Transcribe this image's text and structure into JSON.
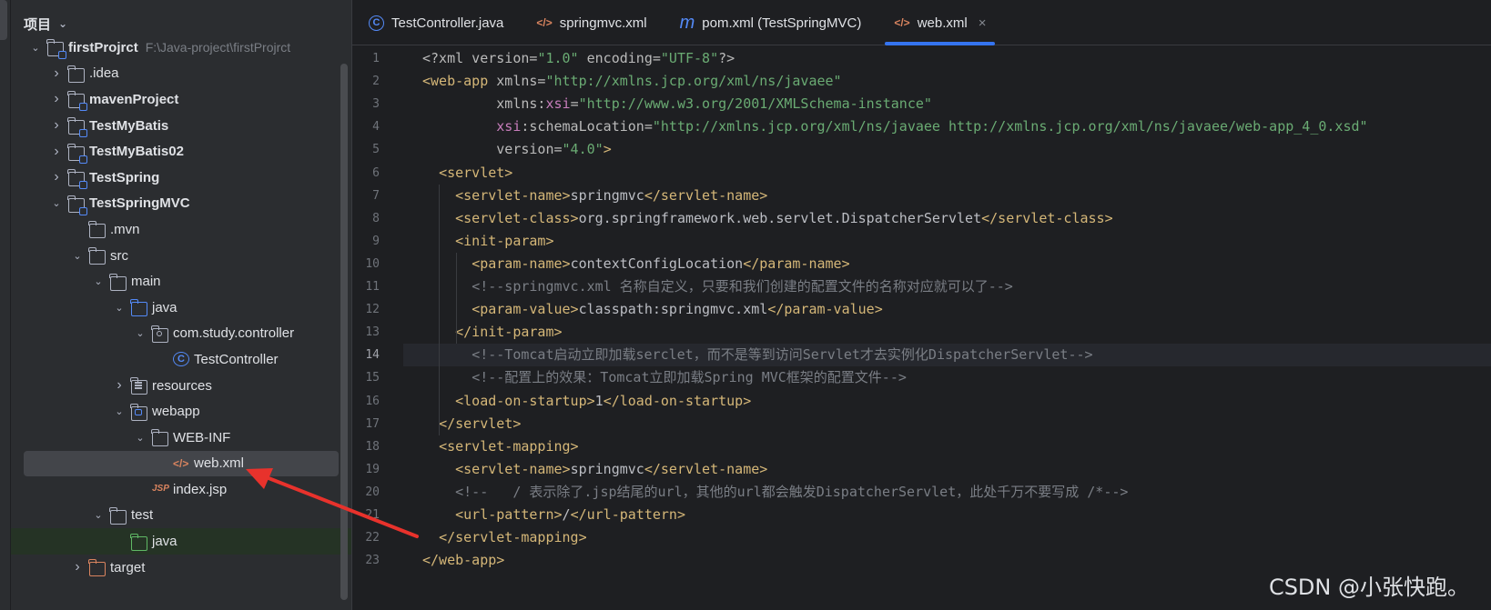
{
  "project_panel": {
    "title": "项目",
    "tree": [
      {
        "label": "firstProjrct",
        "path": "F:\\Java-project\\firstProjrct",
        "indent": 0,
        "arrow": "open",
        "icon": "module",
        "bold": true
      },
      {
        "label": ".idea",
        "indent": 1,
        "arrow": "closed",
        "icon": "folder"
      },
      {
        "label": "mavenProject",
        "indent": 1,
        "arrow": "closed",
        "icon": "module",
        "bold": true
      },
      {
        "label": "TestMyBatis",
        "indent": 1,
        "arrow": "closed",
        "icon": "module",
        "bold": true
      },
      {
        "label": "TestMyBatis02",
        "indent": 1,
        "arrow": "closed",
        "icon": "module",
        "bold": true
      },
      {
        "label": "TestSpring",
        "indent": 1,
        "arrow": "closed",
        "icon": "module",
        "bold": true
      },
      {
        "label": "TestSpringMVC",
        "indent": 1,
        "arrow": "open",
        "icon": "module",
        "bold": true
      },
      {
        "label": ".mvn",
        "indent": 2,
        "arrow": "none",
        "icon": "folder"
      },
      {
        "label": "src",
        "indent": 2,
        "arrow": "open",
        "icon": "folder"
      },
      {
        "label": "main",
        "indent": 3,
        "arrow": "open",
        "icon": "folder"
      },
      {
        "label": "java",
        "indent": 4,
        "arrow": "open",
        "icon": "folder-blue"
      },
      {
        "label": "com.study.controller",
        "indent": 5,
        "arrow": "open",
        "icon": "package"
      },
      {
        "label": "TestController",
        "indent": 6,
        "arrow": "none",
        "icon": "class"
      },
      {
        "label": "resources",
        "indent": 4,
        "arrow": "closed",
        "icon": "resources"
      },
      {
        "label": "webapp",
        "indent": 4,
        "arrow": "open",
        "icon": "webapp"
      },
      {
        "label": "WEB-INF",
        "indent": 5,
        "arrow": "open",
        "icon": "folder"
      },
      {
        "label": "web.xml",
        "indent": 6,
        "arrow": "none",
        "icon": "xml",
        "selected": true
      },
      {
        "label": "index.jsp",
        "indent": 5,
        "arrow": "none",
        "icon": "jsp"
      },
      {
        "label": "test",
        "indent": 3,
        "arrow": "open",
        "icon": "folder"
      },
      {
        "label": "java",
        "indent": 4,
        "arrow": "none",
        "icon": "folder-green",
        "band": true
      },
      {
        "label": "target",
        "indent": 2,
        "arrow": "closed",
        "icon": "folder-orange"
      }
    ]
  },
  "tabs": [
    {
      "label": "TestController.java",
      "icon": "class-icon",
      "glyph": "C",
      "active": false
    },
    {
      "label": "springmvc.xml",
      "icon": "xml-file-icon",
      "glyph": "</>",
      "active": false
    },
    {
      "label": "pom.xml (TestSpringMVC)",
      "icon": "maven-icon",
      "glyph": "m",
      "active": false
    },
    {
      "label": "web.xml",
      "icon": "xml-file-icon",
      "glyph": "</>",
      "active": true,
      "close": "×"
    }
  ],
  "editor": {
    "current_line": 14,
    "lines": [
      [
        [
          "<?xml version=",
          "a"
        ],
        [
          "\"1.0\"",
          "v"
        ],
        [
          " encoding=",
          "a"
        ],
        [
          "\"UTF-8\"",
          "v"
        ],
        [
          "?>",
          "a"
        ]
      ],
      [
        [
          "<web-app",
          "t"
        ],
        [
          " xmlns=",
          "a"
        ],
        [
          "\"http://xmlns.jcp.org/xml/ns/javaee\"",
          "v"
        ]
      ],
      [
        [
          "         xmlns:",
          "a"
        ],
        [
          "xsi",
          "ns"
        ],
        [
          "=",
          "a"
        ],
        [
          "\"http://www.w3.org/2001/XMLSchema-instance\"",
          "v"
        ]
      ],
      [
        [
          "         ",
          "a"
        ],
        [
          "xsi",
          "ns"
        ],
        [
          ":schemaLocation=",
          "a"
        ],
        [
          "\"http://xmlns.jcp.org/xml/ns/javaee http://xmlns.jcp.org/xml/ns/javaee/web-app_4_0.xsd\"",
          "v"
        ]
      ],
      [
        [
          "         version=",
          "a"
        ],
        [
          "\"4.0\"",
          "v"
        ],
        [
          ">",
          "t"
        ]
      ],
      [
        [
          "  ",
          "tx"
        ],
        [
          "<servlet>",
          "t"
        ]
      ],
      [
        [
          "    ",
          "tx"
        ],
        [
          "<servlet-name>",
          "t"
        ],
        [
          "springmvc",
          "tx"
        ],
        [
          "</servlet-name>",
          "t"
        ]
      ],
      [
        [
          "    ",
          "tx"
        ],
        [
          "<servlet-class>",
          "t"
        ],
        [
          "org.springframework.web.servlet.DispatcherServlet",
          "tx"
        ],
        [
          "</servlet-class>",
          "t"
        ]
      ],
      [
        [
          "    ",
          "tx"
        ],
        [
          "<init-param>",
          "t"
        ]
      ],
      [
        [
          "      ",
          "tx"
        ],
        [
          "<param-name>",
          "t"
        ],
        [
          "contextConfigLocation",
          "tx"
        ],
        [
          "</param-name>",
          "t"
        ]
      ],
      [
        [
          "      ",
          "tx"
        ],
        [
          "<!--springmvc.xml 名称自定义，只要和我们创建的配置文件的名称对应就可以了-->",
          "cm"
        ]
      ],
      [
        [
          "      ",
          "tx"
        ],
        [
          "<param-value>",
          "t"
        ],
        [
          "classpath:springmvc.xml",
          "tx"
        ],
        [
          "</param-value>",
          "t"
        ]
      ],
      [
        [
          "    ",
          "tx"
        ],
        [
          "</init-param>",
          "t"
        ]
      ],
      [
        [
          "      ",
          "tx"
        ],
        [
          "<!--Tomcat启动立即加载serclet，而不是等到访问Servlet才去实例化DispatcherServlet-->",
          "cm"
        ]
      ],
      [
        [
          "      ",
          "tx"
        ],
        [
          "<!--配置上的效果：Tomcat立即加载Spring MVC框架的配置文件-->",
          "cm"
        ]
      ],
      [
        [
          "    ",
          "tx"
        ],
        [
          "<load-on-startup>",
          "t"
        ],
        [
          "1",
          "tx"
        ],
        [
          "</load-on-startup>",
          "t"
        ]
      ],
      [
        [
          "  ",
          "tx"
        ],
        [
          "</servlet>",
          "t"
        ]
      ],
      [
        [
          "  ",
          "tx"
        ],
        [
          "<servlet-mapping>",
          "t"
        ]
      ],
      [
        [
          "    ",
          "tx"
        ],
        [
          "<servlet-name>",
          "t"
        ],
        [
          "springmvc",
          "tx"
        ],
        [
          "</servlet-name>",
          "t"
        ]
      ],
      [
        [
          "    ",
          "tx"
        ],
        [
          "<!--   / 表示除了.jsp结尾的url，其他的url都会触发DispatcherServlet，此处千万不要写成 /*-->",
          "cm"
        ]
      ],
      [
        [
          "    ",
          "tx"
        ],
        [
          "<url-pattern>",
          "t"
        ],
        [
          "/",
          "tx"
        ],
        [
          "</url-pattern>",
          "t"
        ]
      ],
      [
        [
          "  ",
          "tx"
        ],
        [
          "</servlet-mapping>",
          "t"
        ]
      ],
      [
        [
          "</web-app>",
          "t"
        ]
      ]
    ]
  },
  "watermark": "CSDN @小张快跑。",
  "colors": {
    "accent": "#3574f0",
    "annotation_arrow": "#e8322c"
  }
}
